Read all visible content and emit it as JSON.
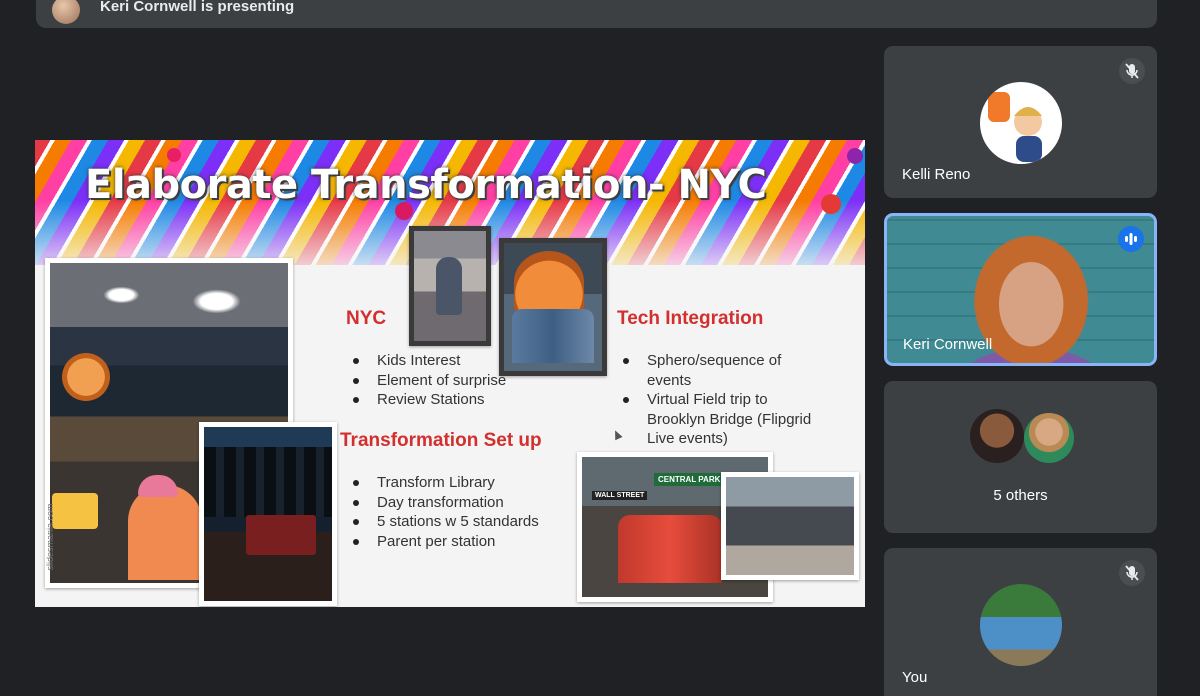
{
  "presenting": {
    "text": "Keri Cornwell is presenting"
  },
  "slide": {
    "title": "Elaborate Transformation- NYC",
    "watermark": "slidesmania.com",
    "sections": {
      "nyc": {
        "heading": "NYC",
        "bullets": [
          "Kids Interest",
          "Element of surprise",
          "Review Stations"
        ]
      },
      "tech": {
        "heading": "Tech Integration",
        "bullets": [
          "Sphero/sequence of events",
          "Virtual Field trip to Brooklyn Bridge (Flipgrid Live events)"
        ]
      },
      "setup": {
        "heading": "Transformation Set up",
        "bullets": [
          "Transform Library",
          "Day transformation",
          "5 stations w 5 standards",
          "Parent per station"
        ]
      }
    },
    "photo_signs": {
      "central_park": "CENTRAL PARK",
      "wall_street": "WALL STREET"
    }
  },
  "participants": [
    {
      "name": "Kelli Reno",
      "mic": "muted",
      "avatar": "bitmoji-foam-finger"
    },
    {
      "name": "Keri Cornwell",
      "mic": "speaking",
      "avatar": "video-feed"
    },
    {
      "name": "5 others",
      "avatar": "group-avatars"
    },
    {
      "name": "You",
      "mic": "muted",
      "avatar": "group-photo"
    }
  ],
  "colors": {
    "background": "#202124",
    "tile": "#3c4043",
    "active_border": "#8ab4f8",
    "speaking_badge": "#1a73e8",
    "heading_red": "#d32f2f"
  }
}
